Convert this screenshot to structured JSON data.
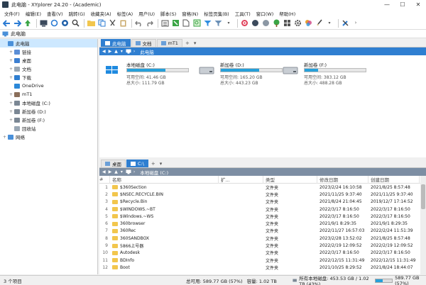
{
  "window": {
    "title": "此电脑 - XYplorer 24.20 - (Academic)",
    "minimize": "—",
    "maximize": "☐",
    "close": "✕"
  },
  "menu": [
    "文件(F)",
    "编辑(E)",
    "查看(V)",
    "跳转(G)",
    "收藏夹(A)",
    "标签(A)",
    "用户(U)",
    "脚本(S)",
    "窗格(N)",
    "标签页集(B)",
    "工具(T)",
    "窗口(W)",
    "帮助(H)"
  ],
  "address": {
    "text": "此电脑"
  },
  "tree": [
    {
      "label": "此电脑",
      "level": 0,
      "expander": "",
      "icon": "#4a90d9",
      "selected": true
    },
    {
      "label": "链接",
      "level": 1,
      "expander": "+",
      "icon": "#5b8ed6"
    },
    {
      "label": "桌面",
      "level": 1,
      "expander": "+",
      "icon": "#3c7fd1"
    },
    {
      "label": "文档",
      "level": 1,
      "expander": "+",
      "icon": "#9aa7b4"
    },
    {
      "label": "下载",
      "level": 1,
      "expander": "+",
      "icon": "#2f7fd1"
    },
    {
      "label": "OneDrive",
      "level": 1,
      "expander": "",
      "icon": "#2b88d8"
    },
    {
      "label": "mT1",
      "level": 1,
      "expander": "+",
      "icon": "#8a6e5a"
    },
    {
      "label": "本地磁盘 (C:)",
      "level": 1,
      "expander": "+",
      "icon": "#7b8794"
    },
    {
      "label": "新加卷 (D:)",
      "level": 1,
      "expander": "+",
      "icon": "#7b8794"
    },
    {
      "label": "新加卷 (F:)",
      "level": 1,
      "expander": "+",
      "icon": "#7b8794"
    },
    {
      "label": "回收站",
      "level": 1,
      "expander": "",
      "icon": "#9aa7b4"
    },
    {
      "label": "网络",
      "level": 0,
      "expander": "+",
      "icon": "#4a90d9"
    }
  ],
  "top_pane": {
    "tabs": [
      {
        "label": "此电脑",
        "active": true
      },
      {
        "label": "文档",
        "active": false
      },
      {
        "label": "mT1",
        "active": false
      }
    ],
    "tab_new": "+",
    "tab_menu": "▾",
    "path": "此电脑",
    "drives": [
      {
        "name": "本地磁盘 (C:)",
        "free": "可用空间: 41.46 GB",
        "total": "总大小: 111.79 GB",
        "used_fraction": 0.63
      },
      {
        "name": "新加卷 (D:)",
        "free": "可用空间: 165.20 GB",
        "total": "总大小: 443.23 GB",
        "used_fraction": 0.63
      },
      {
        "name": "新加卷 (F:)",
        "free": "可用空间: 383.12 GB",
        "total": "总大小: 488.28 GB",
        "used_fraction": 0.22
      }
    ]
  },
  "bottom_pane": {
    "tabs": [
      {
        "label": "桌面",
        "active": false
      },
      {
        "label": "C:\\",
        "active": true
      }
    ],
    "tab_new": "+",
    "tab_menu": "▾",
    "path": "本地磁盘 (C:)",
    "columns": {
      "num": "#",
      "name": "名称",
      "ext": "扩...",
      "type": "类型",
      "modified": "修改日期",
      "created": "创建日期"
    },
    "rows": [
      [
        "1",
        "$360Section",
        "",
        "文件夹",
        "2023/2/24 16:10:58",
        "2021/8/25 8:57:48"
      ],
      [
        "2",
        "$NSEC.RECYCLE.BIN",
        "",
        "文件夹",
        "2021/11/25 9:37:40",
        "2021/11/25 9:37:40"
      ],
      [
        "3",
        "$Recycle.Bin",
        "",
        "文件夹",
        "2021/8/24 21:04:45",
        "2019/12/7 17:14:52"
      ],
      [
        "4",
        "$WINDOWS.~BT",
        "",
        "文件夹",
        "2022/3/17 8:16:50",
        "2022/3/17 8:16:50"
      ],
      [
        "5",
        "$Windows.~WS",
        "",
        "文件夹",
        "2022/3/17 8:16:50",
        "2022/3/17 8:16:50"
      ],
      [
        "6",
        "360browser",
        "",
        "文件夹",
        "2021/9/1 8:29:35",
        "2021/9/1 8:29:35"
      ],
      [
        "7",
        "360Rec",
        "",
        "文件夹",
        "2022/11/27 16:57:03",
        "2022/2/24 11:51:39"
      ],
      [
        "8",
        "360SANDBOX",
        "",
        "文件夹",
        "2023/2/28 13:52:02",
        "2021/8/25 8:57:48"
      ],
      [
        "9",
        "5866上号器",
        "",
        "文件夹",
        "2022/2/19 12:09:52",
        "2022/2/19 12:09:52"
      ],
      [
        "10",
        "Autodesk",
        "",
        "文件夹",
        "2022/3/17 8:16:50",
        "2022/3/17 8:16:50"
      ],
      [
        "11",
        "BDInfo",
        "",
        "文件夹",
        "2022/12/15 11:31:49",
        "2022/12/15 11:31:49"
      ],
      [
        "12",
        "Boot",
        "",
        "文件夹",
        "2021/10/25 8:29:52",
        "2021/8/24 18:44:07"
      ]
    ]
  },
  "status": {
    "count": "3 个项目",
    "total": "总可用: 589.77 GB (57%)",
    "capacity": "容量: 1.02 TB",
    "drive_info": "所有本地磁盘: 453.53 GB / 1.02 TB (43%)",
    "free_percent": "589.77 GB (57%)",
    "used_fraction": 0.43
  }
}
